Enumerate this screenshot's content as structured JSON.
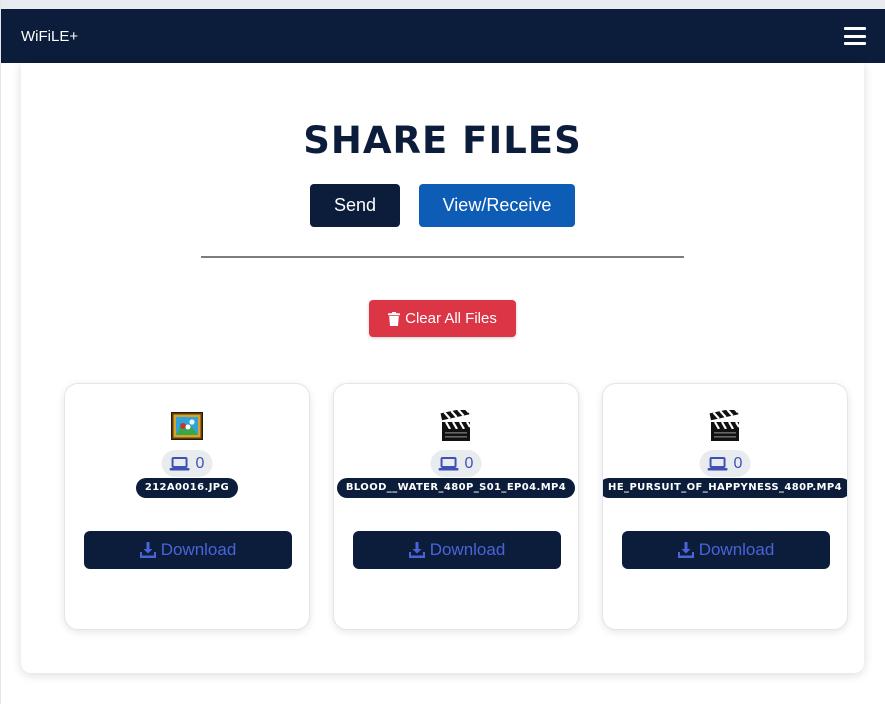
{
  "app": {
    "brand": "WiFiLE+"
  },
  "page": {
    "title": "SHARE FILES",
    "send_label": "Send",
    "view_label": "View/Receive",
    "clear_label": "Clear All Files"
  },
  "files": [
    {
      "name": "212A0016.JPG",
      "type_icon": "image-file-icon",
      "device_count": "0",
      "download_label": "Download"
    },
    {
      "name": "BLOOD__WATER_480P_S01_EP04.MP4",
      "type_icon": "video-clapper-icon",
      "device_count": "0",
      "download_label": "Download"
    },
    {
      "name": "HE_PURSUIT_OF_HAPPYNESS_480P.MP4",
      "type_icon": "video-clapper-icon",
      "device_count": "0",
      "download_label": "Download"
    }
  ],
  "colors": {
    "navy": "#0b1d3a",
    "blue": "#0d5cb6",
    "danger": "#dc3545",
    "download_text": "#4a63d8"
  }
}
